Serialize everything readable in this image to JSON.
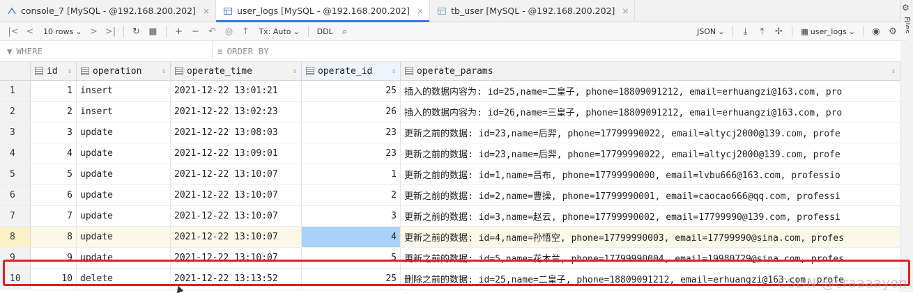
{
  "tabs": [
    {
      "label": "console_7 [MySQL - @192.168.200.202]",
      "icon": "console-icon",
      "active": false
    },
    {
      "label": "user_logs [MySQL - @192.168.200.202]",
      "icon": "table-icon",
      "active": true
    },
    {
      "label": "tb_user [MySQL - @192.168.200.202]",
      "icon": "table-icon",
      "active": false
    }
  ],
  "tab_close": "×",
  "sidebar_right": {
    "label": "Files"
  },
  "toolbar": {
    "rows_label": "10 rows",
    "tx_label": "Tx: Auto",
    "ddl_label": "DDL",
    "format_label": "JSON",
    "table_label": "user_logs"
  },
  "filters": {
    "where_label": "WHERE",
    "orderby_label": "ORDER BY"
  },
  "columns": [
    {
      "name": "id"
    },
    {
      "name": "operation"
    },
    {
      "name": "operate_time"
    },
    {
      "name": "operate_id"
    },
    {
      "name": "operate_params"
    }
  ],
  "rows": [
    {
      "n": "1",
      "id": "1",
      "operation": "insert",
      "time": "2021-12-22 13:01:21",
      "operate_id": "25",
      "params": "插入的数据内容为: id=25,name=二皇子, phone=18809091212, email=erhuangzi@163.com, pro"
    },
    {
      "n": "2",
      "id": "2",
      "operation": "insert",
      "time": "2021-12-22 13:02:23",
      "operate_id": "26",
      "params": "插入的数据内容为: id=26,name=三皇子, phone=18809091212, email=erhuangzi@163.com, pro"
    },
    {
      "n": "3",
      "id": "3",
      "operation": "update",
      "time": "2021-12-22 13:08:03",
      "operate_id": "23",
      "params": "更新之前的数据: id=23,name=后羿, phone=17799990022, email=altycj2000@139.com, profe"
    },
    {
      "n": "4",
      "id": "4",
      "operation": "update",
      "time": "2021-12-22 13:09:01",
      "operate_id": "23",
      "params": "更新之前的数据: id=23,name=后羿, phone=17799990022, email=altycj2000@139.com, profe"
    },
    {
      "n": "5",
      "id": "5",
      "operation": "update",
      "time": "2021-12-22 13:10:07",
      "operate_id": "1",
      "params": "更新之前的数据: id=1,name=吕布, phone=17799990000, email=lvbu666@163.com, professio"
    },
    {
      "n": "6",
      "id": "6",
      "operation": "update",
      "time": "2021-12-22 13:10:07",
      "operate_id": "2",
      "params": "更新之前的数据: id=2,name=曹操, phone=17799990001, email=caocao666@qq.com, professi"
    },
    {
      "n": "7",
      "id": "7",
      "operation": "update",
      "time": "2021-12-22 13:10:07",
      "operate_id": "3",
      "params": "更新之前的数据: id=3,name=赵云, phone=17799990002, email=17799990@139.com, professi"
    },
    {
      "n": "8",
      "id": "8",
      "operation": "update",
      "time": "2021-12-22 13:10:07",
      "operate_id": "4",
      "params": "更新之前的数据: id=4,name=孙悟空, phone=17799990003, email=17799990@sina.com, profes"
    },
    {
      "n": "9",
      "id": "9",
      "operation": "update",
      "time": "2021-12-22 13:10:07",
      "operate_id": "5",
      "params": "更新之前的数据: id=5,name=花木兰, phone=17799990004, email=19980729@sina.com, profes"
    },
    {
      "n": "10",
      "id": "10",
      "operation": "delete",
      "time": "2021-12-22 13:13:52",
      "operate_id": "25",
      "params": "删除之前的数据: id=25,name=二皇子, phone=18809091212, email=erhuangzi@163.com, profe"
    }
  ],
  "selected_row": "8",
  "watermark": "CSDN @craaaayon",
  "colors": {
    "accent": "#3574f0",
    "highlight_box": "#e02020",
    "selected_cell": "#a9d2f8",
    "row_highlight": "#fbf8e8"
  }
}
